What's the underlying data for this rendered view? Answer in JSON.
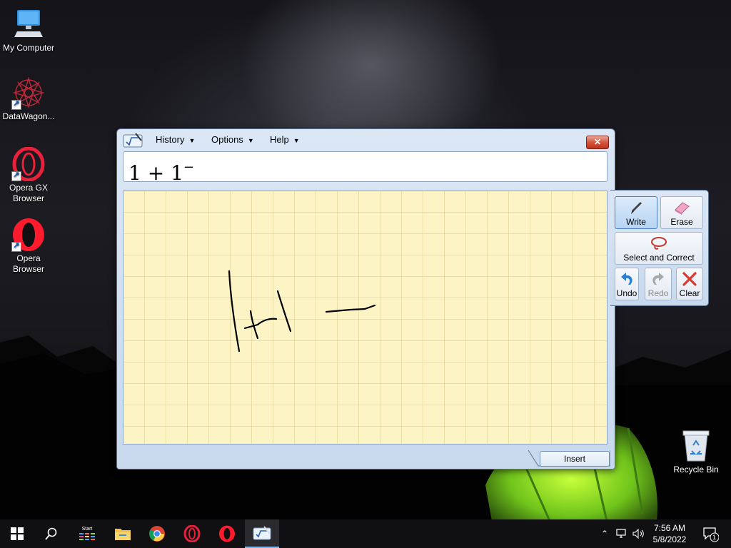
{
  "desktop": {
    "icons": [
      {
        "label": "My Computer"
      },
      {
        "label": "DataWagon..."
      },
      {
        "label": "Opera GX Browser"
      },
      {
        "label": "Opera Browser"
      },
      {
        "label": "Recycle Bin"
      }
    ]
  },
  "math_input_panel": {
    "menus": [
      {
        "label": "History"
      },
      {
        "label": "Options"
      },
      {
        "label": "Help"
      }
    ],
    "close_label": "✕",
    "preview": {
      "expression": "1 + 1",
      "superscript": "−"
    },
    "insert_label": "Insert",
    "tools": {
      "write": "Write",
      "erase": "Erase",
      "select_correct": "Select and Correct",
      "undo": "Undo",
      "redo": "Redo",
      "clear": "Clear"
    }
  },
  "taskbar": {
    "start_label": "Start",
    "clock": {
      "time": "7:56 AM",
      "date": "5/8/2022"
    },
    "notification_count": "1"
  },
  "colors": {
    "canvas_bg": "#fdf4c6",
    "window_bg": "#dbe7f5",
    "taskbar_bg": "#101012"
  }
}
